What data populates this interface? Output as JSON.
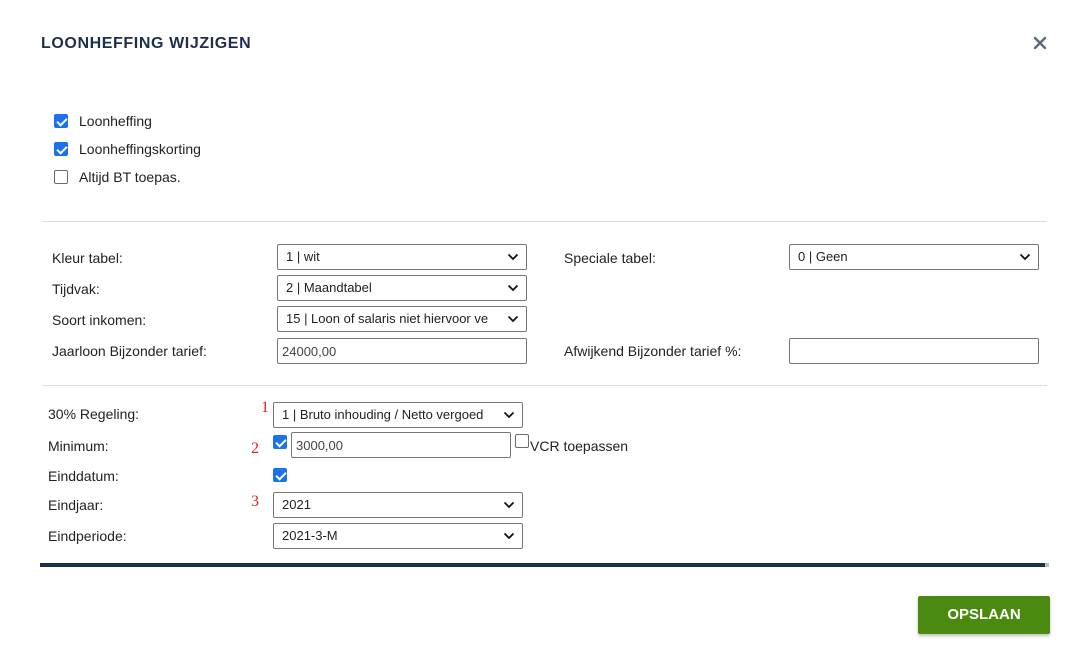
{
  "dialog": {
    "title": "LOONHEFFING WIJZIGEN"
  },
  "top_checks": [
    {
      "label": "Loonheffing",
      "checked": true
    },
    {
      "label": "Loonheffingskorting",
      "checked": true
    },
    {
      "label": "Altijd BT toepas.",
      "checked": false
    }
  ],
  "section1": {
    "kleur_tabel": {
      "label": "Kleur tabel:",
      "value": "1 | wit"
    },
    "speciale_tabel": {
      "label": "Speciale tabel:",
      "value": "0 | Geen"
    },
    "tijdvak": {
      "label": "Tijdvak:",
      "value": "2 | Maandtabel"
    },
    "soort_inkomen": {
      "label": "Soort inkomen:",
      "value": "15 | Loon of salaris niet hiervoor ve"
    },
    "jaarloon": {
      "label": "Jaarloon Bijzonder tarief:",
      "value": "24000,00"
    },
    "afwijkend": {
      "label": "Afwijkend Bijzonder tarief %:",
      "value": ""
    }
  },
  "section2": {
    "regeling": {
      "label": "30% Regeling:",
      "value": "1 | Bruto inhouding / Netto vergoed"
    },
    "minimum": {
      "label": "Minimum:",
      "checked": true,
      "value": "3000,00"
    },
    "vcr": {
      "label": "VCR toepassen",
      "checked": false
    },
    "einddatum": {
      "label": "Einddatum:",
      "checked": true
    },
    "eindjaar": {
      "label": "Eindjaar:",
      "value": "2021"
    },
    "eindperiode": {
      "label": "Eindperiode:",
      "value": "2021-3-M"
    }
  },
  "annotations": [
    "1",
    "2",
    "3"
  ],
  "footer": {
    "save_label": "OPSLAAN"
  },
  "colors": {
    "primary": "#1e3049",
    "checkbox": "#1a73e8",
    "save": "#4a8a10",
    "annotation": "#e02020"
  },
  "icons": {
    "close": "close-icon",
    "dropdown": "chevron-down-icon"
  }
}
